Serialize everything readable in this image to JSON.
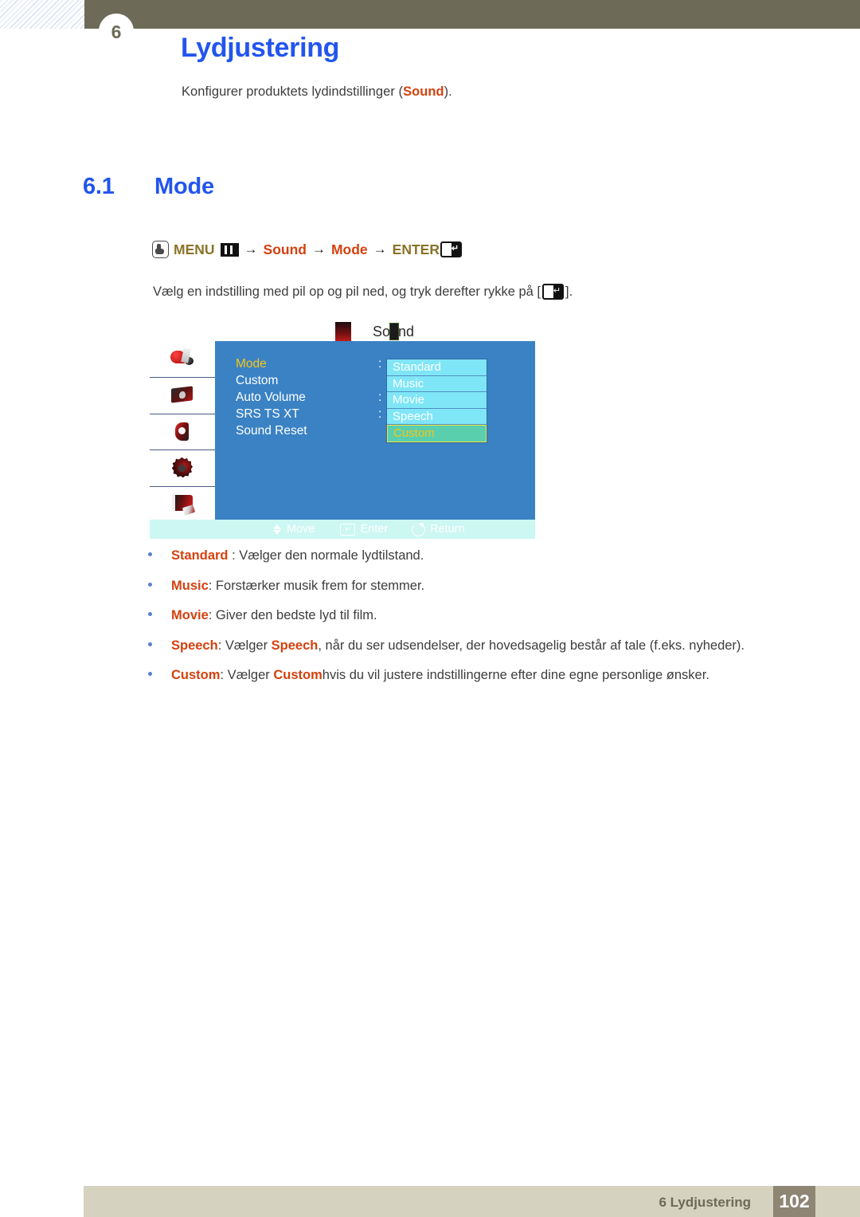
{
  "header": {
    "badge_char": "6"
  },
  "chapter": {
    "title": "Lydjustering",
    "subtitle_prefix": "Konfigurer produktets lydindstillinger (",
    "subtitle_highlight": "Sound",
    "subtitle_suffix": ")."
  },
  "section": {
    "number": "6.1",
    "title": "Mode"
  },
  "menu_path": {
    "hand_icon": "hand-press-icon",
    "menu_label": "MENU",
    "grid_icon": "menu-grid-icon",
    "arrow": "→",
    "item1": "Sound",
    "item2": "Mode",
    "enter_label": "ENTER",
    "enter_icon": "enter-key-icon"
  },
  "instruction": {
    "text_before": "Vælg en indstilling med pil op og pil ned, og tryk derefter rykke på [",
    "text_after": "]."
  },
  "osd": {
    "title": "Sound",
    "marker_icon": "speaker-marker-icon",
    "sidebar_icons": [
      "picture-icon",
      "display-icon",
      "sound-icon",
      "setup-gear-icon",
      "support-book-icon"
    ],
    "rows": [
      {
        "label": "Mode",
        "colon": ":",
        "selected": true
      },
      {
        "label": "Custom",
        "colon": "",
        "selected": false
      },
      {
        "label": "Auto Volume",
        "colon": ":",
        "selected": false
      },
      {
        "label": "SRS TS XT",
        "colon": ":",
        "selected": false
      },
      {
        "label": "Sound Reset",
        "colon": "",
        "selected": false
      }
    ],
    "dropdown": [
      {
        "label": "Standard",
        "active": false
      },
      {
        "label": "Music",
        "active": false
      },
      {
        "label": "Movie",
        "active": false
      },
      {
        "label": "Speech",
        "active": false
      },
      {
        "label": "Custom",
        "active": true
      }
    ],
    "footer": [
      {
        "icon": "up-down-arrows-icon",
        "label": "Move"
      },
      {
        "icon": "enter-key-icon",
        "label": "Enter"
      },
      {
        "icon": "return-arrow-icon",
        "label": "Return"
      }
    ]
  },
  "bullets": [
    {
      "term": "Standard",
      "seg": [
        {
          "t": " : Vælger den normale lydtilstand.",
          "hl": false
        }
      ]
    },
    {
      "term": "Music",
      "seg": [
        {
          "t": ": Forstærker musik frem for stemmer.",
          "hl": false
        }
      ]
    },
    {
      "term": "Movie",
      "seg": [
        {
          "t": ": Giver den bedste lyd til film.",
          "hl": false
        }
      ]
    },
    {
      "term": "Speech",
      "seg": [
        {
          "t": ": Vælger ",
          "hl": false
        },
        {
          "t": "Speech",
          "hl": true
        },
        {
          "t": ", når du ser udsendelser, der hovedsagelig består af tale (f.eks. nyheder).",
          "hl": false
        }
      ]
    },
    {
      "term": "Custom",
      "seg": [
        {
          "t": ": Vælger ",
          "hl": false
        },
        {
          "t": "Custom",
          "hl": true
        },
        {
          "t": "hvis du vil justere indstillingerne efter dine egne personlige ønsker.",
          "hl": false
        }
      ]
    }
  ],
  "footer": {
    "label": "6 Lydjustering",
    "page": "102"
  },
  "colors": {
    "heading_blue": "#2255ee",
    "accent_orange": "#d4410e",
    "path_gold": "#8a7326",
    "header_olive": "#6d6b57",
    "footer_beige": "#d6d2c0",
    "page_box": "#8e8574",
    "osd_blue": "#3a82c4",
    "osd_cyan": "#7fe6f7",
    "osd_active_green": "#59cfae",
    "osd_yellow": "#f5c518",
    "osd_footer_bg": "#ccf7f2"
  }
}
